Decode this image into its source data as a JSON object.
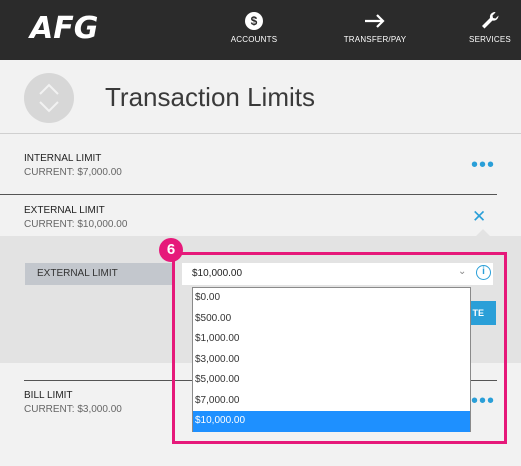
{
  "header": {
    "logo": "AFG",
    "nav": [
      {
        "label": "ACCOUNTS",
        "icon": "dollar-coin-icon"
      },
      {
        "label": "TRANSFER/PAY",
        "icon": "arrow-right-icon"
      },
      {
        "label": "SERVICES",
        "icon": "wrench-icon"
      }
    ]
  },
  "page": {
    "title": "Transaction Limits"
  },
  "limits": {
    "internal": {
      "name": "INTERNAL LIMIT",
      "current": "CURRENT: $7,000.00"
    },
    "external": {
      "name": "EXTERNAL LIMIT",
      "current": "CURRENT: $10,000.00"
    },
    "bill": {
      "name": "BILL LIMIT",
      "current": "CURRENT: $3,000.00"
    }
  },
  "editor": {
    "field_label": "EXTERNAL LIMIT",
    "selected_value": "$10,000.00",
    "update_label": "TE",
    "options": [
      "$0.00",
      "$500.00",
      "$1,000.00",
      "$3,000.00",
      "$5,000.00",
      "$7,000.00",
      "$10,000.00"
    ]
  },
  "callout": {
    "step": "6"
  },
  "colors": {
    "accent": "#2a9fd8",
    "header_bg": "#2b2b2b",
    "highlight": "#e6197a",
    "selected_option": "#1e90ff"
  }
}
